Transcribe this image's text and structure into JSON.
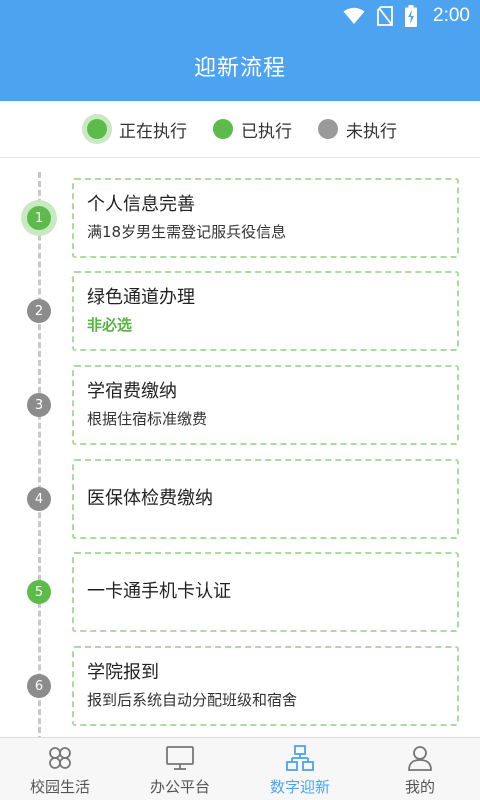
{
  "status_bar": {
    "time": "2:00"
  },
  "header": {
    "title": "迎新流程"
  },
  "legend": [
    {
      "label": "正在执行",
      "state": "current"
    },
    {
      "label": "已执行",
      "state": "done"
    },
    {
      "label": "未执行",
      "state": "pending"
    }
  ],
  "steps": [
    {
      "number": "1",
      "state": "current",
      "title": "个人信息完善",
      "desc": "满18岁男生需登记服兵役信息"
    },
    {
      "number": "2",
      "state": "pending",
      "title": "绿色通道办理",
      "desc": "非必选"
    },
    {
      "number": "3",
      "state": "pending",
      "title": "学宿费缴纳",
      "desc": "根据住宿标准缴费"
    },
    {
      "number": "4",
      "state": "pending",
      "title": "医保体检费缴纳",
      "desc": ""
    },
    {
      "number": "5",
      "state": "done",
      "title": "一卡通手机卡认证",
      "desc": ""
    },
    {
      "number": "6",
      "state": "pending",
      "title": "学院报到",
      "desc": "报到后系统自动分配班级和宿舍"
    }
  ],
  "tabs": [
    {
      "label": "校园生活",
      "icon": "flower-grid-icon",
      "active": false
    },
    {
      "label": "办公平台",
      "icon": "monitor-icon",
      "active": false
    },
    {
      "label": "数字迎新",
      "icon": "org-chart-icon",
      "active": true
    },
    {
      "label": "我的",
      "icon": "user-icon",
      "active": false
    }
  ],
  "colors": {
    "primary": "#4da3ef",
    "green": "#5cbb4a",
    "gray": "#9a9a9a"
  }
}
